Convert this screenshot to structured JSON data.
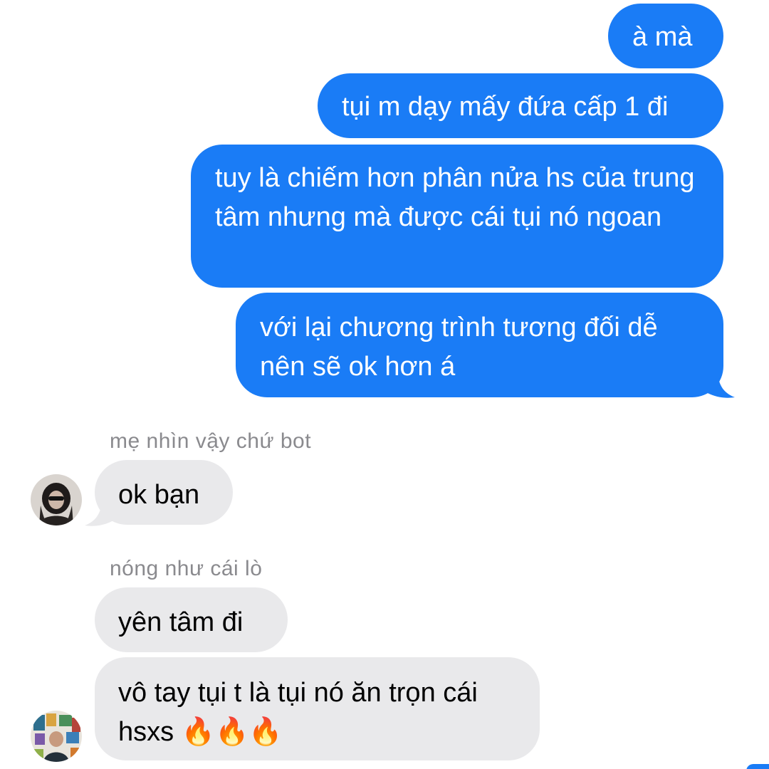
{
  "conversation": {
    "outgoing": [
      {
        "text": "à mà"
      },
      {
        "text": "tụi m dạy mấy đứa cấp 1 đi"
      },
      {
        "text": "tuy là chiếm hơn phân nửa hs của trung tâm nhưng mà được cái tụi nó ngoan"
      },
      {
        "text": "với lại chương trình tương đối dễ nên sẽ ok hơn á"
      }
    ],
    "incoming": [
      {
        "sender": "mẹ nhìn vậy chứ bot",
        "messages": [
          {
            "text": "ok bạn"
          }
        ],
        "avatar_icon": "dark-profile-photo"
      },
      {
        "sender": "nóng như cái lò",
        "messages": [
          {
            "text": "yên tâm đi"
          },
          {
            "text": "vô tay tụi t là tụi nó ăn trọn cái hsxs 🔥🔥🔥"
          }
        ],
        "avatar_icon": "colorful-profile-photo"
      }
    ]
  },
  "colors": {
    "outgoing_bubble": "#1a7cf6",
    "incoming_bubble": "#e9e9eb",
    "sender_label": "#8a8a8e",
    "background": "#ffffff"
  }
}
